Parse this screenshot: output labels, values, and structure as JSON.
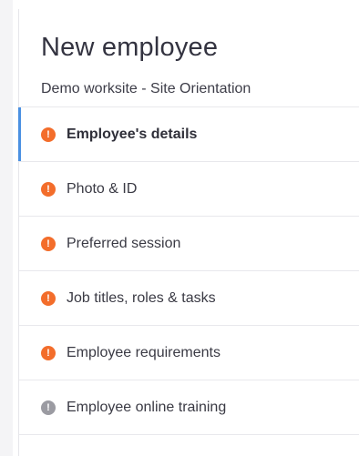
{
  "header": {
    "title": "New employee",
    "subtitle": "Demo worksite - Site Orientation"
  },
  "steps": [
    {
      "label": "Employee's details",
      "status": "warning",
      "active": true
    },
    {
      "label": "Photo & ID",
      "status": "warning",
      "active": false
    },
    {
      "label": "Preferred session",
      "status": "warning",
      "active": false
    },
    {
      "label": "Job titles, roles & tasks",
      "status": "warning",
      "active": false
    },
    {
      "label": "Employee requirements",
      "status": "warning",
      "active": false
    },
    {
      "label": "Employee online training",
      "status": "inactive",
      "active": false
    }
  ],
  "colors": {
    "accent": "#4a90e2",
    "warning": "#f36d2b",
    "inactive": "#9b9ba2"
  },
  "icons": {
    "warning": "exclamation-circle-icon",
    "inactive": "exclamation-circle-icon"
  },
  "icon_glyph": "!"
}
